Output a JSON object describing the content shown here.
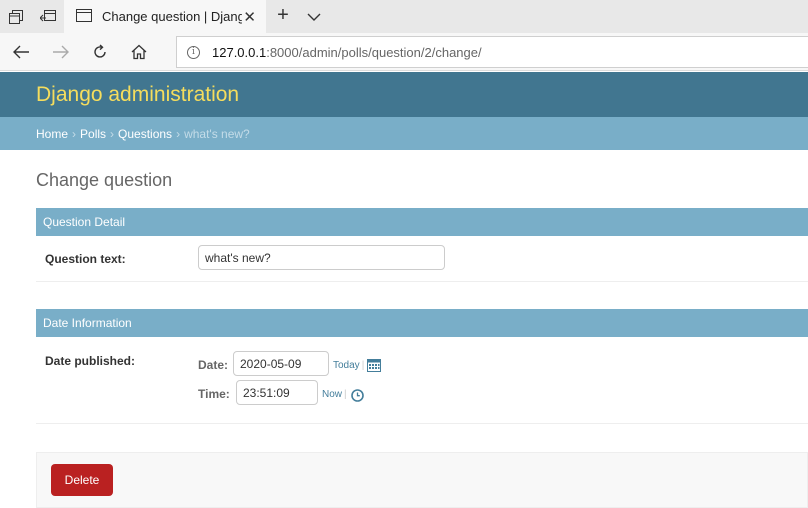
{
  "browser": {
    "tab_title": "Change question | Djang",
    "url_host": "127.0.0.1",
    "url_rest": ":8000/admin/polls/question/2/change/"
  },
  "header": {
    "brand": "Django administration",
    "brand_color": "#f5dd5d",
    "bar_color": "#417690"
  },
  "breadcrumbs": {
    "home": "Home",
    "polls": "Polls",
    "questions": "Questions",
    "current": "what's new?",
    "separator": "›"
  },
  "page": {
    "title": "Change question"
  },
  "question_detail": {
    "heading": "Question Detail",
    "question_text_label": "Question text:",
    "question_text_value": "what's new?"
  },
  "date_information": {
    "heading": "Date Information",
    "date_published_label": "Date published:",
    "date_label": "Date:",
    "date_value": "2020-05-09",
    "today_link": "Today",
    "time_label": "Time:",
    "time_value": "23:51:09",
    "now_link": "Now"
  },
  "actions": {
    "delete_label": "Delete",
    "delete_color": "#ba2121"
  },
  "icons": {
    "tab_actions": "tab-actions-icon",
    "set_aside": "set-aside-tabs-icon",
    "page": "page-icon",
    "close": "close-icon",
    "new_tab": "plus-icon",
    "tab_list": "chevron-down-icon",
    "back": "back-arrow-icon",
    "forward": "forward-arrow-icon",
    "refresh": "refresh-icon",
    "home": "home-icon",
    "info": "info-icon",
    "calendar": "calendar-icon",
    "clock": "clock-icon"
  }
}
